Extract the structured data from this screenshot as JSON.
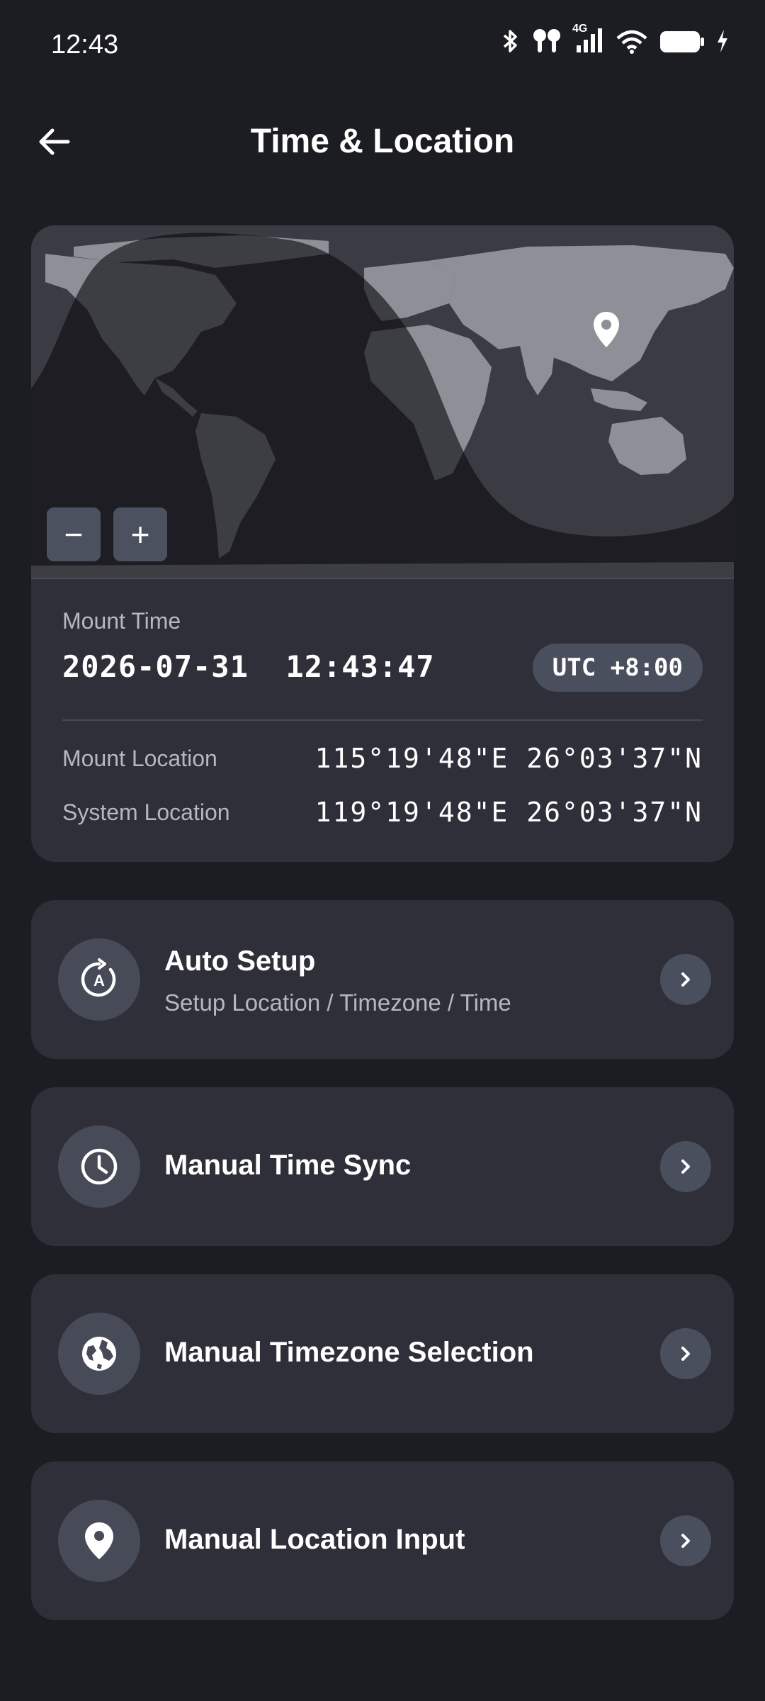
{
  "status_bar": {
    "time": "12:43",
    "icons": [
      "bluetooth-icon",
      "earbuds-icon",
      "signal-4g-icon",
      "wifi-icon",
      "battery-icon",
      "charging-icon"
    ],
    "network_label": "4G"
  },
  "header": {
    "title": "Time & Location",
    "back_icon": "arrow-left-icon"
  },
  "map": {
    "zoom_out_label": "−",
    "zoom_in_label": "+",
    "marker_icon": "location-pin-icon"
  },
  "info": {
    "mount_time_label": "Mount Time",
    "mount_time_value": "2026-07-31  12:43:47",
    "timezone_badge": "UTC +8:00",
    "mount_location_label": "Mount Location",
    "mount_location_value": "115°19'48\"E 26°03'37\"N",
    "system_location_label": "System Location",
    "system_location_value": "119°19'48\"E 26°03'37\"N"
  },
  "menu": [
    {
      "title": "Auto Setup",
      "subtitle": "Setup Location / Timezone / Time",
      "icon": "auto-setup-icon"
    },
    {
      "title": "Manual Time Sync",
      "icon": "clock-icon"
    },
    {
      "title": "Manual Timezone Selection",
      "icon": "globe-icon"
    },
    {
      "title": "Manual Location Input",
      "icon": "location-pin-icon"
    }
  ],
  "colors": {
    "background": "#1c1d22",
    "card": "#2e2f38",
    "icon_circle": "#474b57",
    "badge": "#4a4f5d",
    "secondary_text": "#b6b8c0"
  }
}
